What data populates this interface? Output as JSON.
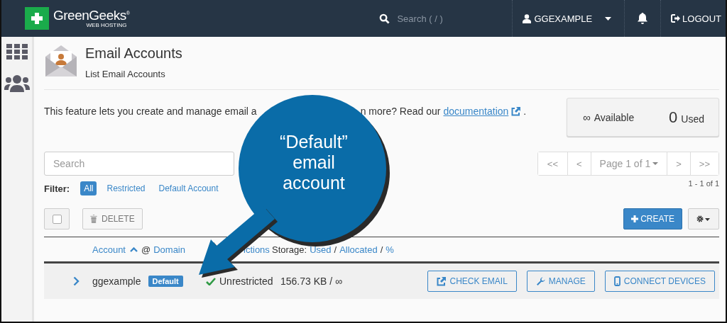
{
  "header": {
    "logo": {
      "name": "GreenGeeks",
      "mark": "®",
      "tagline": "WEB HOSTING"
    },
    "search": {
      "placeholder": "Search ( / )"
    },
    "user": "GGEXAMPLE",
    "logout": "LOGOUT"
  },
  "page": {
    "title": "Email Accounts",
    "subtitle": "List Email Accounts"
  },
  "description": {
    "before": "This feature lets you create and manage email a",
    "after": "n more? Read our",
    "link": "documentation",
    "end": "."
  },
  "stats": [
    {
      "kind": "infinite",
      "value": "∞",
      "label": "Available"
    },
    {
      "kind": "count",
      "value": "0",
      "label": "Used"
    }
  ],
  "search": {
    "placeholder": "Search"
  },
  "filter": {
    "label": "Filter:",
    "options": [
      {
        "label": "All",
        "selected": true
      },
      {
        "label": "Restricted",
        "selected": false
      },
      {
        "label": "Default Account",
        "selected": false
      }
    ]
  },
  "pagination": {
    "buttons": [
      "<<",
      "<",
      "Page 1 of 1",
      ">",
      ">>"
    ],
    "range": "1 - 1 of 1"
  },
  "toolbar": {
    "select_all": {
      "checked": false
    },
    "delete": {
      "label": "DELETE",
      "disabled": true
    },
    "create": "CREATE"
  },
  "table": {
    "columns": [
      {
        "label": "Account",
        "link": true,
        "sort_ascending": true
      },
      {
        "label": "@",
        "link": false
      },
      {
        "label": "Domain",
        "link": true
      },
      {
        "label": "ictions",
        "link": true
      },
      {
        "label": "Storage:",
        "link": false
      },
      {
        "label": "Used",
        "link": true
      },
      {
        "label": "/",
        "link": false
      },
      {
        "label": "Allocated",
        "link": true
      },
      {
        "label": "/",
        "link": false
      },
      {
        "label": "%",
        "link": true
      }
    ],
    "rows": [
      {
        "account": "ggexample",
        "badge": "Default",
        "restriction": "Unrestricted",
        "restricted": false,
        "storage": "156.73 KB / ∞",
        "actions": [
          "CHECK EMAIL",
          "MANAGE",
          "CONNECT DEVICES"
        ]
      }
    ]
  },
  "callout": {
    "text": "“Default” email account"
  }
}
